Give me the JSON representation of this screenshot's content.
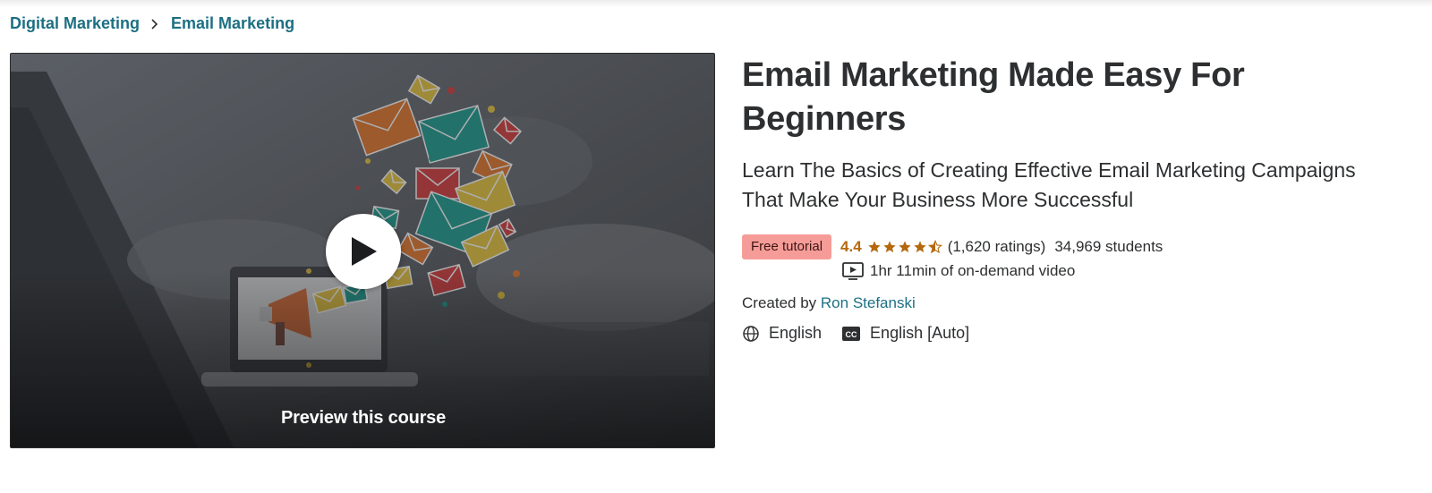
{
  "breadcrumb": [
    {
      "label": "Digital Marketing"
    },
    {
      "label": "Email Marketing"
    }
  ],
  "preview": {
    "label": "Preview this course"
  },
  "course": {
    "title_line1": "Email Marketing Made Easy For",
    "title_line2": "Beginners",
    "subtitle_line1": "Learn The Basics of Creating Effective Email Marketing Campaigns",
    "subtitle_line2": "That Make Your Business More Successful",
    "badge": "Free tutorial",
    "rating": "4.4",
    "rating_value": 4.4,
    "ratings_count": "(1,620 ratings)",
    "students": "34,969 students",
    "video_length": "1hr 11min of on-demand video",
    "created_by_label": "Created by",
    "instructor": "Ron Stefanski",
    "language": "English",
    "captions": "English [Auto]"
  },
  "colors": {
    "link": "#1c6f83",
    "rating": "#b4690e",
    "badge_bg": "#f69c98"
  },
  "icons": [
    "chevron-right-icon",
    "play-icon",
    "star-icon",
    "video-icon",
    "globe-icon",
    "closed-captions-icon"
  ]
}
